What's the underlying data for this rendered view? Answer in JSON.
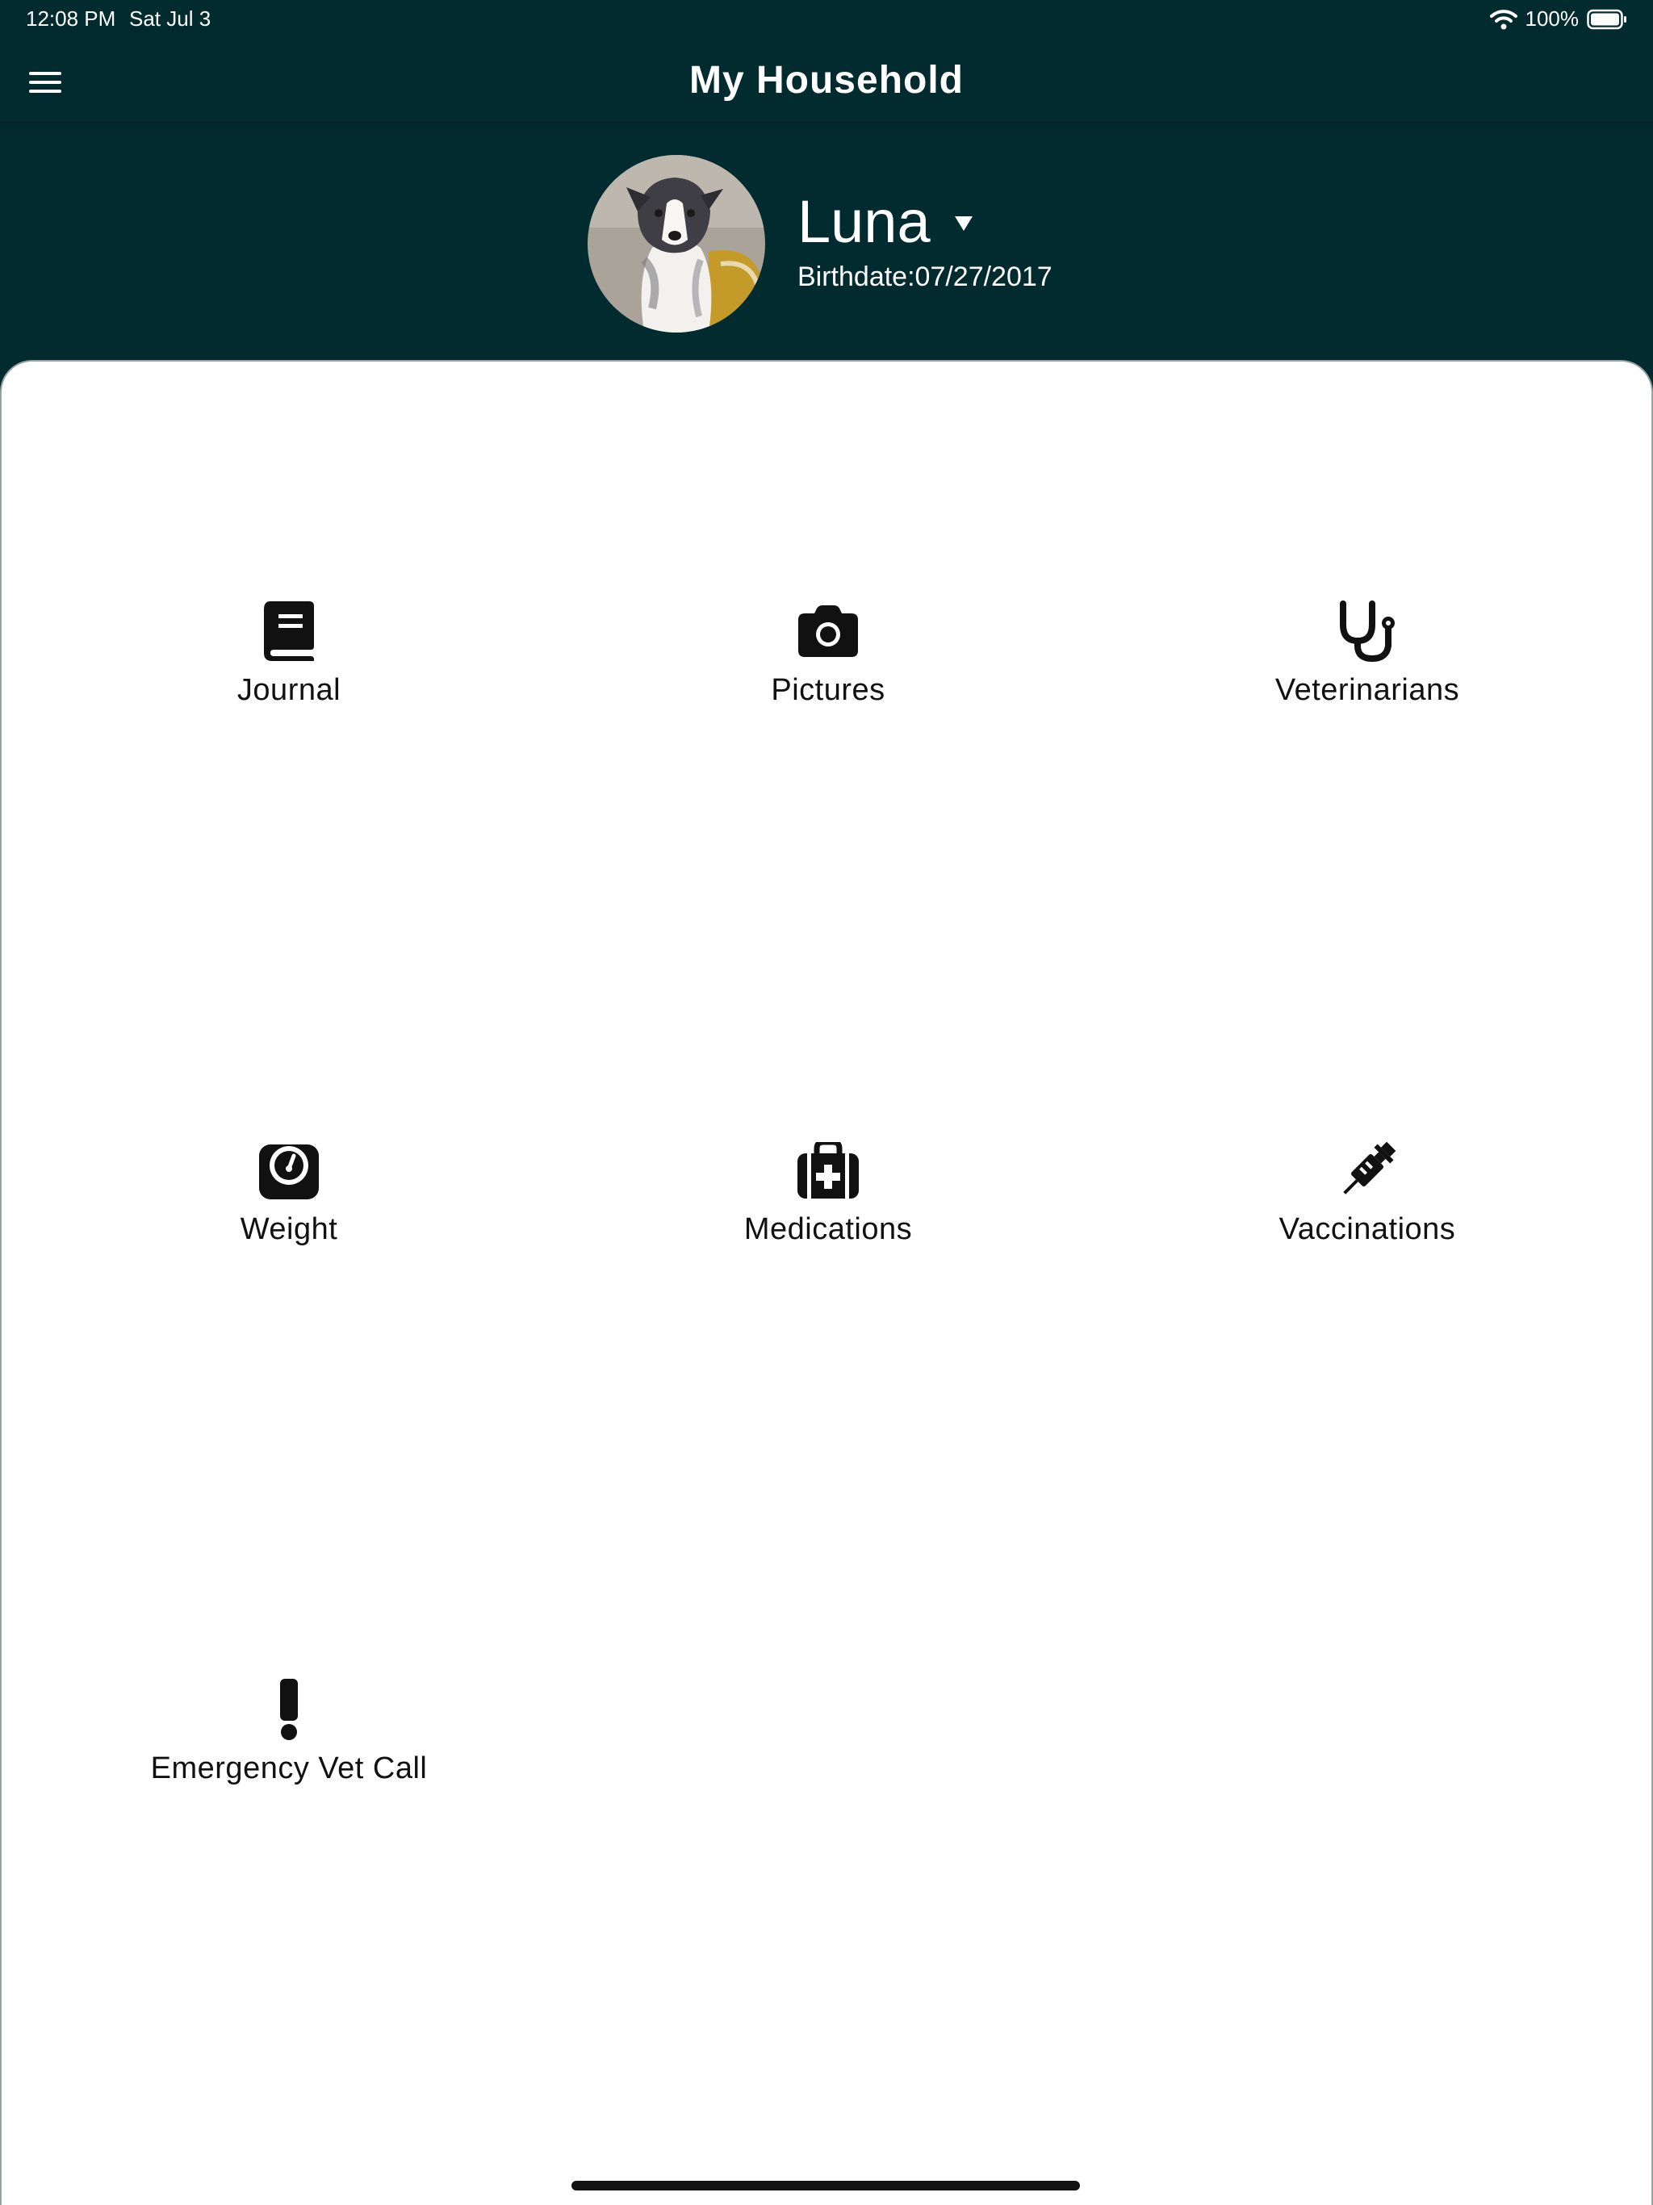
{
  "status_bar": {
    "time": "12:08 PM",
    "date": "Sat Jul 3",
    "battery": "100%",
    "icons": [
      "wifi-icon",
      "battery-icon"
    ]
  },
  "app_bar": {
    "title": "My Household",
    "menu_icon": "hamburger-menu-icon"
  },
  "pet": {
    "name": "Luna",
    "birthdate": "Birthdate:07/27/2017",
    "dropdown_icon": "caret-down-icon"
  },
  "tiles": [
    {
      "label": "Journal",
      "icon": "book-icon"
    },
    {
      "label": "Pictures",
      "icon": "camera-icon"
    },
    {
      "label": "Veterinarians",
      "icon": "stethoscope-icon"
    },
    {
      "label": "Weight",
      "icon": "weight-scale-icon"
    },
    {
      "label": "Medications",
      "icon": "medical-kit-icon"
    },
    {
      "label": "Vaccinations",
      "icon": "syringe-icon"
    },
    {
      "label": "Emergency Vet Call",
      "icon": "exclamation-icon"
    }
  ],
  "colors": {
    "header_background": "#022b30",
    "content_background": "#ffffff",
    "text_on_header": "#ffffff",
    "icon_color": "#111111"
  }
}
